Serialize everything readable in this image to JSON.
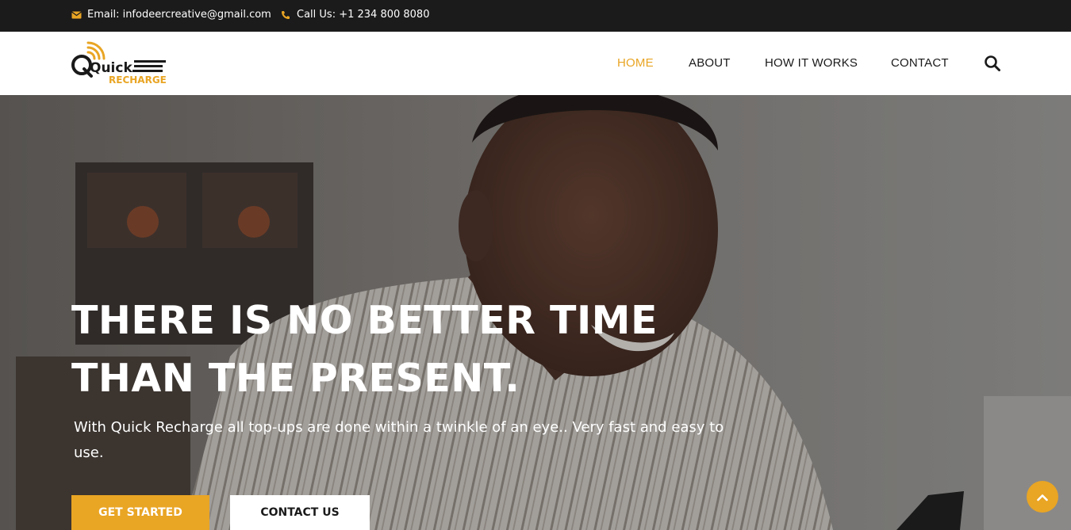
{
  "topbar": {
    "email": "Email: infodeercreative@gmail.com",
    "phone": "Call Us: +1 234 800 8080",
    "email_icon": "envelope-icon",
    "phone_icon": "phone-icon"
  },
  "brand": {
    "logo_word_1": "Quick",
    "logo_word_2": "RECHARGE",
    "accent_color": "#e9a524"
  },
  "nav": {
    "items": [
      {
        "label": "HOME",
        "active": true
      },
      {
        "label": "ABOUT",
        "active": false
      },
      {
        "label": "HOW IT WORKS",
        "active": false
      },
      {
        "label": "CONTACT",
        "active": false
      }
    ],
    "search_icon": "search-icon"
  },
  "hero": {
    "headline_line1": "THERE IS NO BETTER TIME",
    "headline_line2": "THAN THE PRESENT.",
    "subtext": "With Quick Recharge all top-ups are done within a twinkle of an eye.. Very fast and easy to use.",
    "primary_button": "GET STARTED",
    "secondary_button": "CONTACT US",
    "scroll_top_icon": "chevron-up-icon"
  }
}
